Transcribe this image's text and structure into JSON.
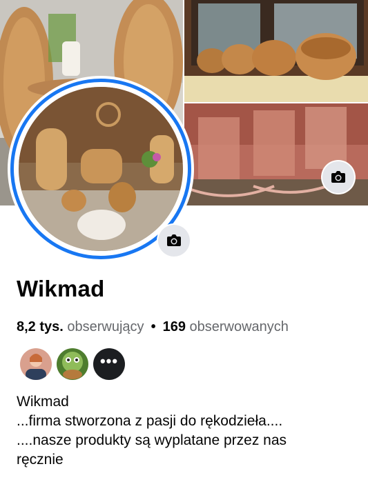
{
  "profile": {
    "name": "Wikmad"
  },
  "stats": {
    "followers_count": "8,2 tys.",
    "followers_label": "obserwujący",
    "separator": "•",
    "following_count": "169",
    "following_label": "obserwowanych"
  },
  "mutual_followers": {
    "more_glyph": "•••"
  },
  "bio": {
    "lines": [
      "Wikmad",
      "...firma stworzona z pasji do rękodzieła....",
      "....nasze produkty są wyplatane przez nas",
      "ręcznie"
    ]
  },
  "icons": {
    "cover_camera": "camera-icon",
    "avatar_camera": "camera-icon"
  },
  "colors": {
    "story_ring": "#1877f2",
    "muted_text": "#65676b",
    "button_bg": "#e4e6eb"
  }
}
